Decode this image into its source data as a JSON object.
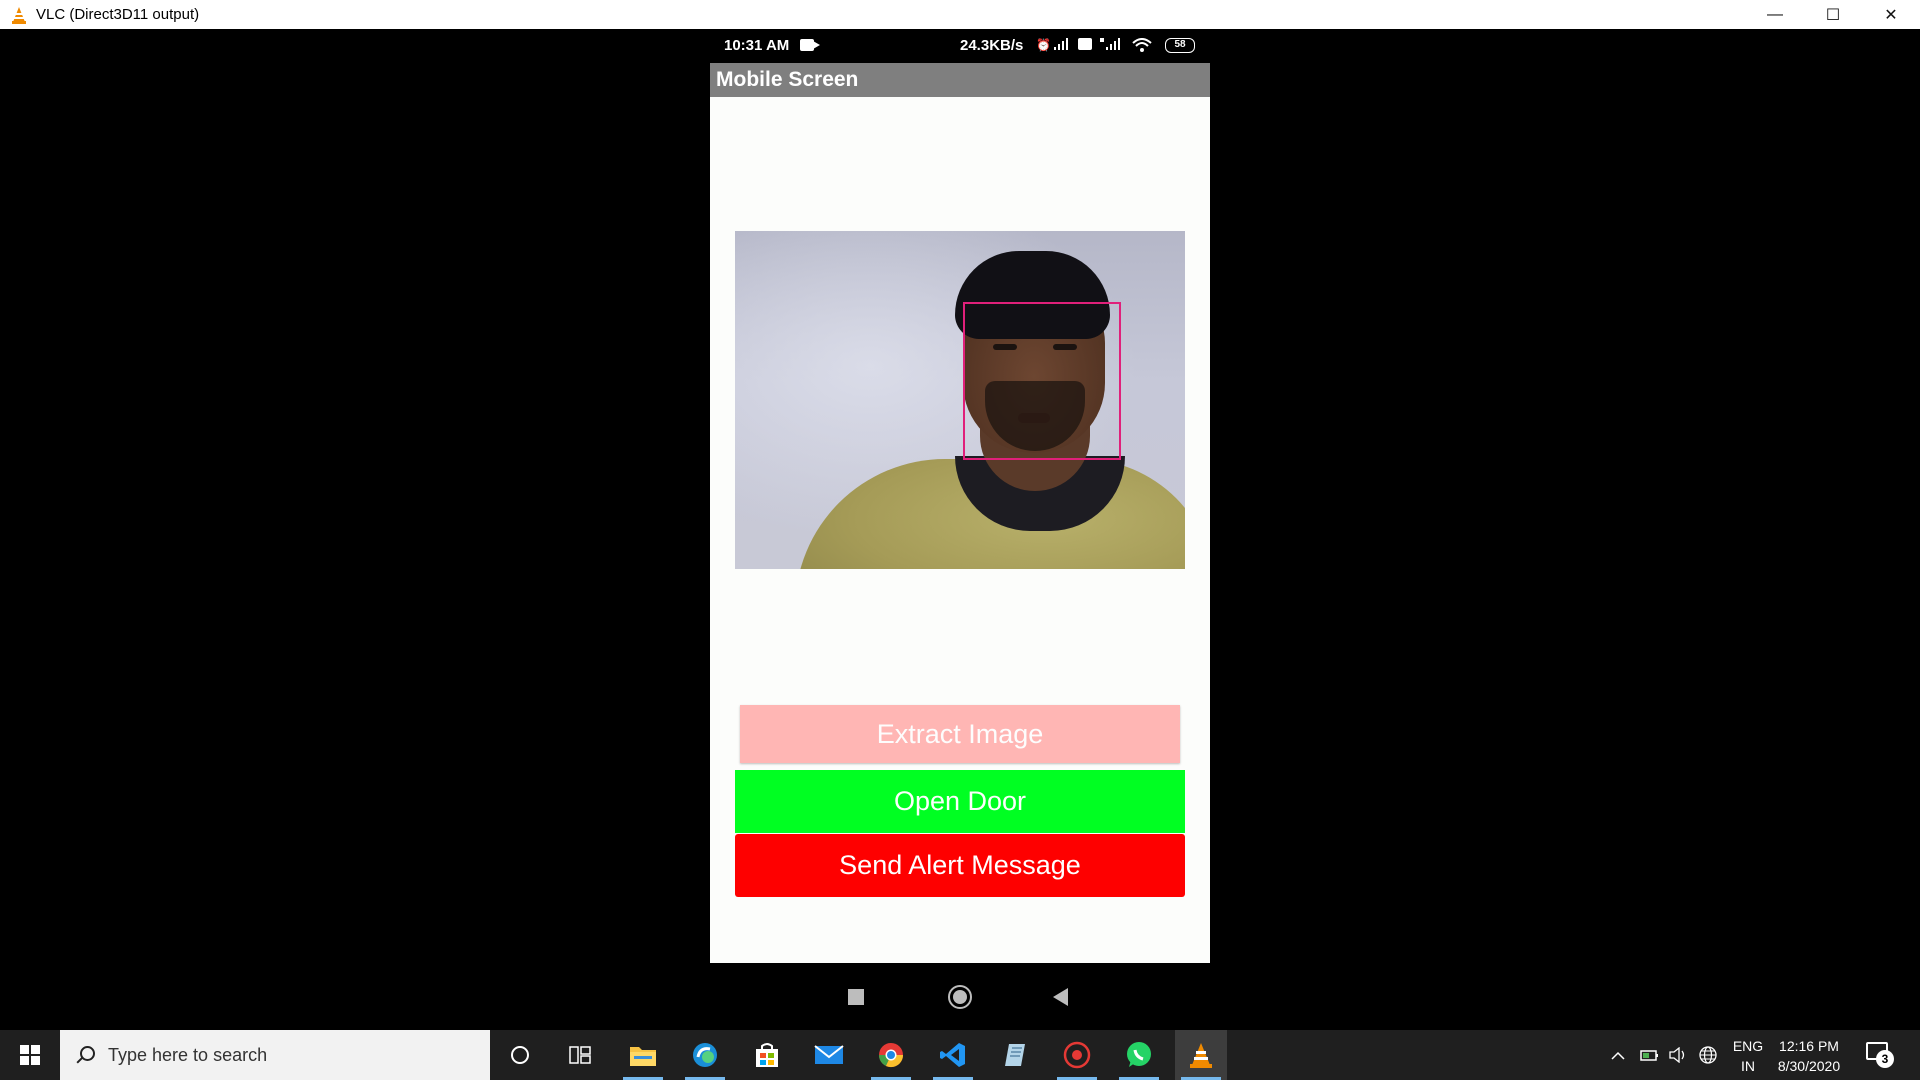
{
  "window": {
    "title": "VLC (Direct3D11 output)",
    "controls": {
      "minimize": "—",
      "maximize": "☐",
      "close": "✕"
    }
  },
  "phone": {
    "status_bar": {
      "time": "10:31 AM",
      "data_rate": "24.3KB/s",
      "battery": "58"
    },
    "app_title": "Mobile Screen",
    "buttons": {
      "extract": "Extract Image",
      "open_door": "Open Door",
      "send_alert": "Send Alert Message"
    },
    "colors": {
      "app_bar": "#7f7f7f",
      "extract": "#ffb6b4",
      "open_door": "#00ff22",
      "send_alert": "#fe0000",
      "face_box": "#e0207a"
    }
  },
  "taskbar": {
    "search_placeholder": "Type here to search",
    "language": {
      "line1": "ENG",
      "line2": "IN"
    },
    "clock": {
      "time": "12:16 PM",
      "date": "8/30/2020"
    },
    "notifications_count": "3",
    "pinned": [
      "cortana-icon",
      "task-view-icon",
      "file-explorer-icon",
      "edge-icon",
      "store-icon",
      "mail-icon",
      "chrome-icon",
      "vscode-icon",
      "notepad-icon",
      "screen-recorder-icon",
      "whatsapp-icon",
      "vlc-icon"
    ]
  }
}
